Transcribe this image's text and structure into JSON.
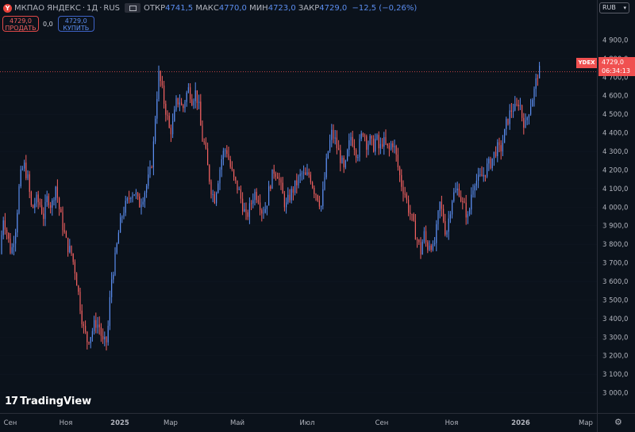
{
  "symbol": {
    "logo": "Y",
    "name": "МКПАО ЯНДЕКС",
    "timeframe": "1Д",
    "exchange": "RUS",
    "separator": "·"
  },
  "ohlc": {
    "open_label": "ОТКР",
    "open": "4741,5",
    "high_label": "МАКС",
    "high": "4770,0",
    "low_label": "МИН",
    "low": "4723,0",
    "close_label": "ЗАКР",
    "close": "4729,0",
    "change": "−12,5 (−0,26%)"
  },
  "trade": {
    "sell_price": "4729,0",
    "sell_label": "ПРОДАТЬ",
    "spread": "0,0",
    "buy_price": "4729,0",
    "buy_label": "КУПИТЬ"
  },
  "currency": "RUB",
  "last_price": {
    "ticker": "YDEX",
    "value": "4729,0",
    "countdown": "06:34:13"
  },
  "brand": {
    "mark": "17",
    "name": "TradingView"
  },
  "colors": {
    "background": "#0b121b",
    "up": "#5b8def",
    "down": "#f06060",
    "grid": "#1c2433",
    "axis_text": "#b2b5be",
    "price_line": "#f05050"
  },
  "chart_data": {
    "type": "candlestick",
    "title": "",
    "ylim": [
      2930,
      5030
    ],
    "yticks": [
      "3 000,0",
      "3 100,0",
      "3 200,0",
      "3 300,0",
      "3 400,0",
      "3 500,0",
      "3 600,0",
      "3 700,0",
      "3 800,0",
      "3 900,0",
      "4 000,0",
      "4 100,0",
      "4 200,0",
      "4 300,0",
      "4 400,0",
      "4 500,0",
      "4 600,0",
      "4 700,0",
      "4 800,0",
      "4 900,0"
    ],
    "xticks": [
      "Сен",
      "Ноя",
      "2025",
      "Мар",
      "Май",
      "Июл",
      "Сен",
      "Ноя",
      "2026",
      "Мар"
    ],
    "last_close": 4729.0,
    "series_points": [
      [
        0,
        3750
      ],
      [
        4,
        3950
      ],
      [
        8,
        3880
      ],
      [
        14,
        3750
      ],
      [
        20,
        3900
      ],
      [
        25,
        4150
      ],
      [
        30,
        4230
      ],
      [
        35,
        4150
      ],
      [
        40,
        3980
      ],
      [
        45,
        4040
      ],
      [
        50,
        4020
      ],
      [
        55,
        3950
      ],
      [
        60,
        4060
      ],
      [
        65,
        4000
      ],
      [
        70,
        4120
      ],
      [
        75,
        3980
      ],
      [
        80,
        3880
      ],
      [
        84,
        3800
      ],
      [
        90,
        3750
      ],
      [
        95,
        3650
      ],
      [
        100,
        3500
      ],
      [
        105,
        3350
      ],
      [
        110,
        3280
      ],
      [
        115,
        3320
      ],
      [
        120,
        3380
      ],
      [
        125,
        3360
      ],
      [
        130,
        3260
      ],
      [
        135,
        3280
      ],
      [
        140,
        3600
      ],
      [
        145,
        3720
      ],
      [
        150,
        3880
      ],
      [
        155,
        3980
      ],
      [
        160,
        4020
      ],
      [
        165,
        4080
      ],
      [
        170,
        4080
      ],
      [
        175,
        4010
      ],
      [
        180,
        4060
      ],
      [
        185,
        4120
      ],
      [
        190,
        4200
      ],
      [
        193,
        4310
      ],
      [
        196,
        4520
      ],
      [
        200,
        4710
      ],
      [
        203,
        4660
      ],
      [
        206,
        4580
      ],
      [
        210,
        4500
      ],
      [
        214,
        4400
      ],
      [
        218,
        4450
      ],
      [
        222,
        4560
      ],
      [
        226,
        4580
      ],
      [
        230,
        4520
      ],
      [
        234,
        4600
      ],
      [
        238,
        4640
      ],
      [
        242,
        4580
      ],
      [
        246,
        4620
      ],
      [
        250,
        4560
      ],
      [
        254,
        4380
      ],
      [
        258,
        4330
      ],
      [
        262,
        4200
      ],
      [
        266,
        4100
      ],
      [
        270,
        4040
      ],
      [
        275,
        4160
      ],
      [
        280,
        4280
      ],
      [
        285,
        4320
      ],
      [
        290,
        4220
      ],
      [
        295,
        4140
      ],
      [
        300,
        4100
      ],
      [
        305,
        4020
      ],
      [
        310,
        3940
      ],
      [
        315,
        4000
      ],
      [
        320,
        4080
      ],
      [
        325,
        4060
      ],
      [
        330,
        3980
      ],
      [
        335,
        4000
      ],
      [
        340,
        4120
      ],
      [
        345,
        4200
      ],
      [
        350,
        4180
      ],
      [
        355,
        4080
      ],
      [
        360,
        4000
      ],
      [
        365,
        4060
      ],
      [
        370,
        4100
      ],
      [
        375,
        4140
      ],
      [
        380,
        4180
      ],
      [
        385,
        4160
      ],
      [
        390,
        4180
      ],
      [
        395,
        4100
      ],
      [
        400,
        4060
      ],
      [
        405,
        4000
      ],
      [
        410,
        4200
      ],
      [
        414,
        4320
      ],
      [
        418,
        4400
      ],
      [
        422,
        4360
      ],
      [
        426,
        4300
      ],
      [
        430,
        4250
      ],
      [
        434,
        4180
      ],
      [
        438,
        4300
      ],
      [
        442,
        4380
      ],
      [
        446,
        4340
      ],
      [
        450,
        4280
      ],
      [
        454,
        4360
      ],
      [
        458,
        4420
      ],
      [
        462,
        4340
      ],
      [
        466,
        4360
      ],
      [
        470,
        4320
      ],
      [
        474,
        4380
      ],
      [
        478,
        4300
      ],
      [
        482,
        4360
      ],
      [
        486,
        4330
      ],
      [
        490,
        4300
      ],
      [
        494,
        4360
      ],
      [
        498,
        4300
      ],
      [
        502,
        4200
      ],
      [
        506,
        4120
      ],
      [
        510,
        4080
      ],
      [
        514,
        4000
      ],
      [
        518,
        3950
      ],
      [
        522,
        3880
      ],
      [
        526,
        3820
      ],
      [
        530,
        3760
      ],
      [
        534,
        3860
      ],
      [
        538,
        3780
      ],
      [
        542,
        3820
      ],
      [
        546,
        3760
      ],
      [
        550,
        3880
      ],
      [
        554,
        4020
      ],
      [
        558,
        3950
      ],
      [
        562,
        3850
      ],
      [
        566,
        3960
      ],
      [
        570,
        4060
      ],
      [
        574,
        4080
      ],
      [
        578,
        4100
      ],
      [
        582,
        4020
      ],
      [
        586,
        3990
      ],
      [
        590,
        3930
      ],
      [
        594,
        4080
      ],
      [
        598,
        4150
      ],
      [
        602,
        4140
      ],
      [
        606,
        4160
      ],
      [
        610,
        4180
      ],
      [
        614,
        4220
      ],
      [
        618,
        4240
      ],
      [
        622,
        4280
      ],
      [
        626,
        4320
      ],
      [
        630,
        4300
      ],
      [
        634,
        4360
      ],
      [
        638,
        4450
      ],
      [
        642,
        4500
      ],
      [
        646,
        4540
      ],
      [
        650,
        4520
      ],
      [
        654,
        4580
      ],
      [
        658,
        4480
      ],
      [
        662,
        4440
      ],
      [
        666,
        4520
      ],
      [
        670,
        4580
      ],
      [
        674,
        4640
      ],
      [
        677,
        4720
      ],
      [
        680,
        4729
      ]
    ]
  }
}
